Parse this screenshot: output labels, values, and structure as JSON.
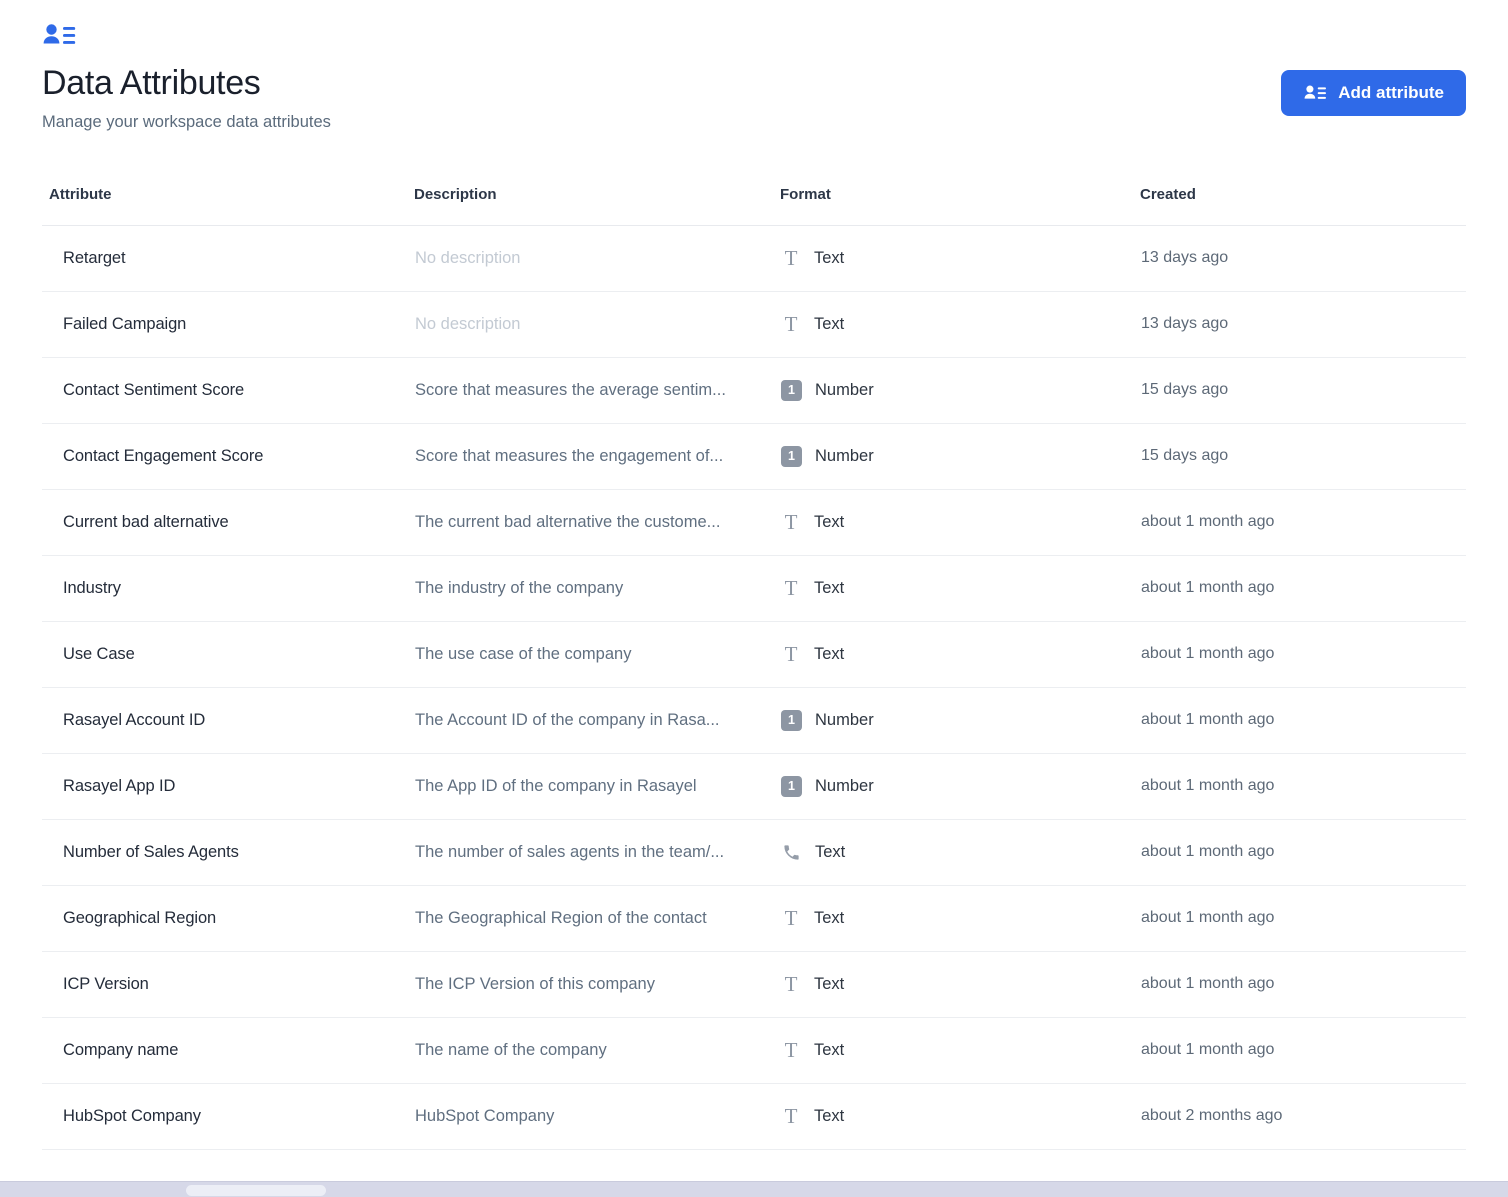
{
  "header": {
    "icon": "contact-list-icon",
    "title": "Data Attributes",
    "subtitle": "Manage your workspace data attributes",
    "add_button": {
      "label": "Add attribute",
      "icon": "contact-list-icon",
      "color": "#2f6ae8"
    }
  },
  "table": {
    "columns": [
      {
        "key": "attribute",
        "label": "Attribute"
      },
      {
        "key": "description",
        "label": "Description"
      },
      {
        "key": "format",
        "label": "Format"
      },
      {
        "key": "created",
        "label": "Created"
      }
    ],
    "empty_description_text": "No description",
    "rows": [
      {
        "attribute": "Retarget",
        "description": "No description",
        "description_empty": true,
        "format": "Text",
        "format_icon": "text-format-icon",
        "created": "13 days ago"
      },
      {
        "attribute": "Failed Campaign",
        "description": "No description",
        "description_empty": true,
        "format": "Text",
        "format_icon": "text-format-icon",
        "created": "13 days ago"
      },
      {
        "attribute": "Contact Sentiment Score",
        "description": "Score that measures the average sentim...",
        "description_empty": false,
        "format": "Number",
        "format_icon": "number-format-icon",
        "created": "15 days ago"
      },
      {
        "attribute": "Contact Engagement Score",
        "description": "Score that measures the engagement of...",
        "description_empty": false,
        "format": "Number",
        "format_icon": "number-format-icon",
        "created": "15 days ago"
      },
      {
        "attribute": "Current bad alternative",
        "description": "The current bad alternative the custome...",
        "description_empty": false,
        "format": "Text",
        "format_icon": "text-format-icon",
        "created": "about 1 month ago"
      },
      {
        "attribute": "Industry",
        "description": "The industry of the company",
        "description_empty": false,
        "format": "Text",
        "format_icon": "text-format-icon",
        "created": "about 1 month ago"
      },
      {
        "attribute": "Use Case",
        "description": "The use case of the company",
        "description_empty": false,
        "format": "Text",
        "format_icon": "text-format-icon",
        "created": "about 1 month ago"
      },
      {
        "attribute": "Rasayel Account ID",
        "description": "The Account ID of the company in Rasa...",
        "description_empty": false,
        "format": "Number",
        "format_icon": "number-format-icon",
        "created": "about 1 month ago"
      },
      {
        "attribute": "Rasayel App ID",
        "description": "The App ID of the company in Rasayel",
        "description_empty": false,
        "format": "Number",
        "format_icon": "number-format-icon",
        "created": "about 1 month ago"
      },
      {
        "attribute": "Number of Sales Agents",
        "description": "The number of sales agents in the team/...",
        "description_empty": false,
        "format": "Text",
        "format_icon": "phone-format-icon",
        "created": "about 1 month ago"
      },
      {
        "attribute": "Geographical Region",
        "description": "The Geographical Region of the contact",
        "description_empty": false,
        "format": "Text",
        "format_icon": "text-format-icon",
        "created": "about 1 month ago"
      },
      {
        "attribute": "ICP Version",
        "description": "The ICP Version of this company",
        "description_empty": false,
        "format": "Text",
        "format_icon": "text-format-icon",
        "created": "about 1 month ago"
      },
      {
        "attribute": "Company name",
        "description": "The name of the company",
        "description_empty": false,
        "format": "Text",
        "format_icon": "text-format-icon",
        "created": "about 1 month ago"
      },
      {
        "attribute": "HubSpot Company",
        "description": "HubSpot Company",
        "description_empty": false,
        "format": "Text",
        "format_icon": "text-format-icon",
        "created": "about 2 months ago"
      }
    ]
  },
  "scrollbar": {
    "orientation": "horizontal",
    "name": "horizontal-scrollbar"
  }
}
